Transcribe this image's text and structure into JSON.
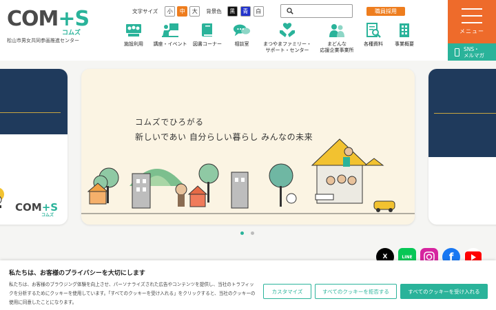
{
  "header": {
    "logo_main": "COM",
    "logo_plus": "+S",
    "logo_sub": "コムズ",
    "logo_caption": "松山市男女共同参画推進センター",
    "font_size_label": "文字サイズ",
    "font_sizes": [
      "小",
      "中",
      "大"
    ],
    "font_size_selected": "中",
    "bg_label": "背景色",
    "bg_colors": [
      "黒",
      "青",
      "白"
    ],
    "search_placeholder": "",
    "recruit_label": "職員採用",
    "menu_label": "メニュー",
    "sns_line1": "SNS・",
    "sns_line2": "メルマガ"
  },
  "nav": [
    {
      "label": "施設利用",
      "icon": "people-meeting-icon"
    },
    {
      "label": "講座・イベント",
      "icon": "lecture-icon"
    },
    {
      "label": "図書コーナー",
      "icon": "book-icon"
    },
    {
      "label": "相談室",
      "icon": "chat-bubble-icon"
    },
    {
      "label": "まつやまファミリー・サポート・センター",
      "line1": "まつやまファミリー・",
      "line2": "サポート・センター",
      "icon": "helping-hands-icon"
    },
    {
      "label": "まどんな応援企業事業所",
      "line1": "まどんな",
      "line2": "応援企業事業所",
      "icon": "group-icon"
    },
    {
      "label": "各種資料",
      "icon": "document-search-icon"
    },
    {
      "label": "事業概要",
      "icon": "building-icon"
    }
  ],
  "carousel": {
    "main_line1": "コムズでひろがる",
    "main_line2": "新しいであい 自分らしい暮らし みんなの未来",
    "left_logo": "COM",
    "left_logo_plus": "+S",
    "left_logo_sub": "コムズ",
    "slides_count": 2,
    "active_index": 0
  },
  "social": [
    {
      "name": "x-icon",
      "label": "X",
      "color": "#000000"
    },
    {
      "name": "line-icon",
      "label": "LINE",
      "color": "#06c755"
    },
    {
      "name": "instagram-icon",
      "label": "",
      "color": "#d6249f"
    },
    {
      "name": "facebook-icon",
      "label": "f",
      "color": "#1877f2"
    },
    {
      "name": "youtube-icon",
      "label": "",
      "color": "#ff0000"
    }
  ],
  "cookie": {
    "title": "私たちは、お客様のプライバシーを大切にします",
    "text": "私たちは、お客様のブラウジング体験を向上させ、パーソナライズされた広告やコンテンツを提供し、当社のトラフィックを分析するためにクッキーを使用しています。「すべてのクッキーを受け入れる」をクリックすると、当社のクッキーの使用に同意したことになります。",
    "customize": "カスタマイズ",
    "reject_all": "すべてのクッキーを拒否する",
    "accept_all": "すべてのクッキーを受け入れる"
  },
  "colors": {
    "orange": "#ee7d1e",
    "menu_orange": "#ee6b2b",
    "teal": "#2ab39a",
    "navy": "#1f3a5c"
  }
}
